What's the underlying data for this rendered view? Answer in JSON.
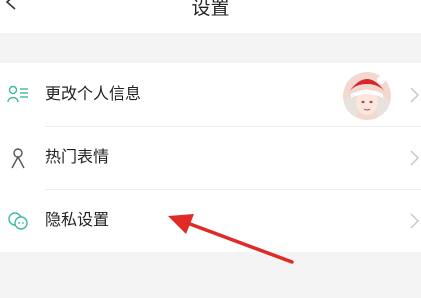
{
  "header": {
    "title": "设置",
    "back_icon": "chevron-left-icon"
  },
  "settings": {
    "items": [
      {
        "label": "更改个人信息",
        "icon": "person-list-icon"
      },
      {
        "label": "热门表情",
        "icon": "person-icon"
      },
      {
        "label": "隐私设置",
        "icon": "chat-bubbles-icon"
      }
    ]
  },
  "colors": {
    "icon_teal": "#3fb9a0",
    "arrow_red": "#e02a25",
    "chevron_gray": "#c8c8c8"
  }
}
